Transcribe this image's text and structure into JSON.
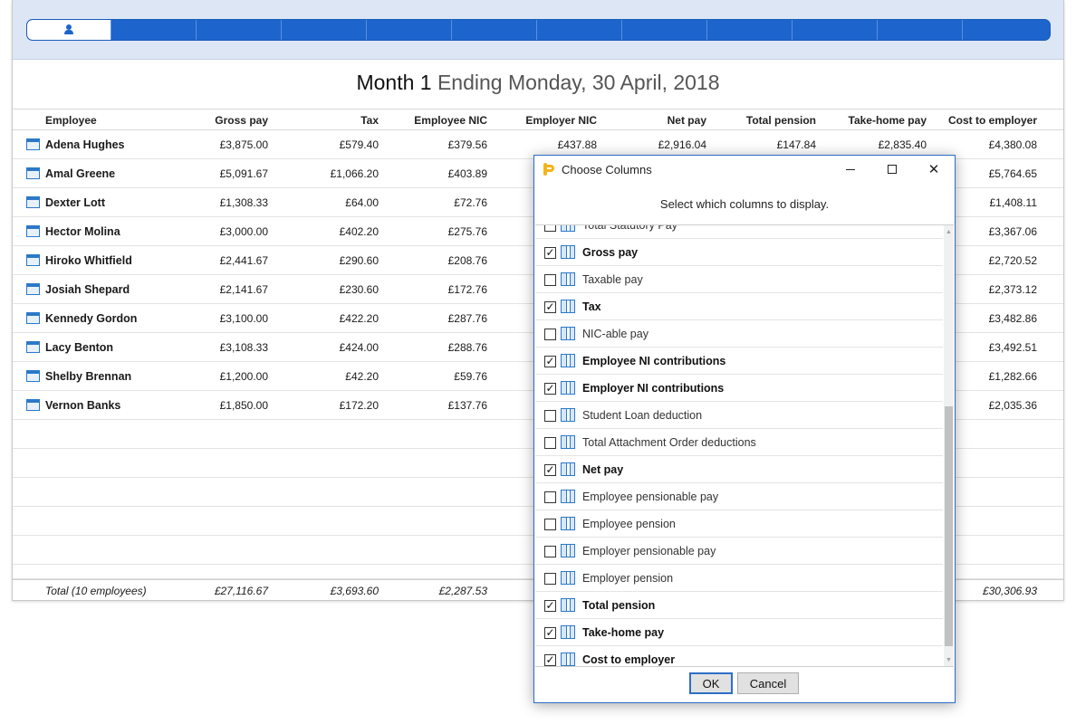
{
  "header": {
    "title_strong": "Month 1",
    "title_light": "Ending Monday, 30 April, 2018",
    "tabs_icon": "person-icon"
  },
  "table": {
    "columns": [
      "Employee",
      "Gross pay",
      "Tax",
      "Employee NIC",
      "Employer NIC",
      "Net pay",
      "Total pension",
      "Take-home pay",
      "Cost to employer"
    ],
    "rows": [
      {
        "name": "Adena Hughes",
        "gross": "£3,875.00",
        "tax": "£579.40",
        "ee_nic": "£379.56",
        "er_nic": "£437.88",
        "net": "£2,916.04",
        "pension": "£147.84",
        "takehome": "£2,835.40",
        "cost": "£4,380.08"
      },
      {
        "name": "Amal Greene",
        "gross": "£5,091.67",
        "tax": "£1,066.20",
        "ee_nic": "£403.89",
        "er_nic": "",
        "net": "",
        "pension": "",
        "takehome": "",
        "cost": "£5,764.65"
      },
      {
        "name": "Dexter Lott",
        "gross": "£1,308.33",
        "tax": "£64.00",
        "ee_nic": "£72.76",
        "er_nic": "",
        "net": "",
        "pension": "",
        "takehome": "",
        "cost": "£1,408.11"
      },
      {
        "name": "Hector Molina",
        "gross": "£3,000.00",
        "tax": "£402.20",
        "ee_nic": "£275.76",
        "er_nic": "",
        "net": "",
        "pension": "",
        "takehome": "",
        "cost": "£3,367.06"
      },
      {
        "name": "Hiroko Whitfield",
        "gross": "£2,441.67",
        "tax": "£290.60",
        "ee_nic": "£208.76",
        "er_nic": "",
        "net": "",
        "pension": "",
        "takehome": "",
        "cost": "£2,720.52"
      },
      {
        "name": "Josiah Shepard",
        "gross": "£2,141.67",
        "tax": "£230.60",
        "ee_nic": "£172.76",
        "er_nic": "",
        "net": "",
        "pension": "",
        "takehome": "",
        "cost": "£2,373.12"
      },
      {
        "name": "Kennedy Gordon",
        "gross": "£3,100.00",
        "tax": "£422.20",
        "ee_nic": "£287.76",
        "er_nic": "",
        "net": "",
        "pension": "",
        "takehome": "",
        "cost": "£3,482.86"
      },
      {
        "name": "Lacy Benton",
        "gross": "£3,108.33",
        "tax": "£424.00",
        "ee_nic": "£288.76",
        "er_nic": "",
        "net": "",
        "pension": "",
        "takehome": "",
        "cost": "£3,492.51"
      },
      {
        "name": "Shelby Brennan",
        "gross": "£1,200.00",
        "tax": "£42.20",
        "ee_nic": "£59.76",
        "er_nic": "",
        "net": "",
        "pension": "",
        "takehome": "",
        "cost": "£1,282.66"
      },
      {
        "name": "Vernon Banks",
        "gross": "£1,850.00",
        "tax": "£172.20",
        "ee_nic": "£137.76",
        "er_nic": "",
        "net": "",
        "pension": "",
        "takehome": "",
        "cost": "£2,035.36"
      }
    ],
    "total": {
      "label": "Total (10 employees)",
      "gross": "£27,116.67",
      "tax": "£3,693.60",
      "ee_nic": "£2,287.53",
      "cost": "£30,306.93"
    }
  },
  "dialog": {
    "title": "Choose Columns",
    "subtitle": "Select which columns to display.",
    "items": [
      {
        "label": "Total Statutory Pay",
        "checked": false
      },
      {
        "label": "Gross pay",
        "checked": true
      },
      {
        "label": "Taxable pay",
        "checked": false
      },
      {
        "label": "Tax",
        "checked": true
      },
      {
        "label": "NIC-able pay",
        "checked": false
      },
      {
        "label": "Employee NI contributions",
        "checked": true
      },
      {
        "label": "Employer NI contributions",
        "checked": true
      },
      {
        "label": "Student Loan deduction",
        "checked": false
      },
      {
        "label": "Total Attachment Order deductions",
        "checked": false
      },
      {
        "label": "Net pay",
        "checked": true
      },
      {
        "label": "Employee pensionable pay",
        "checked": false
      },
      {
        "label": "Employee pension",
        "checked": false
      },
      {
        "label": "Employer pensionable pay",
        "checked": false
      },
      {
        "label": "Employer pension",
        "checked": false
      },
      {
        "label": "Total pension",
        "checked": true
      },
      {
        "label": "Take-home pay",
        "checked": true
      },
      {
        "label": "Cost to employer",
        "checked": true
      }
    ],
    "ok_label": "OK",
    "cancel_label": "Cancel",
    "check_glyph": "✓"
  }
}
